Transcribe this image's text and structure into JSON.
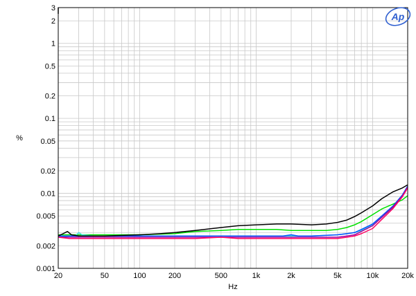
{
  "chart_data": {
    "type": "line",
    "title": "",
    "xlabel": "Hz",
    "ylabel": "%",
    "x_scale": "log",
    "y_scale": "log",
    "xlim": [
      20,
      20000
    ],
    "ylim": [
      0.001,
      3
    ],
    "grid": true,
    "legend": "none",
    "x_ticks": [
      {
        "value": 20,
        "label": "20"
      },
      {
        "value": 50,
        "label": "50"
      },
      {
        "value": 100,
        "label": "100"
      },
      {
        "value": 200,
        "label": "200"
      },
      {
        "value": 500,
        "label": "500"
      },
      {
        "value": 1000,
        "label": "1k"
      },
      {
        "value": 2000,
        "label": "2k"
      },
      {
        "value": 5000,
        "label": "5k"
      },
      {
        "value": 10000,
        "label": "10k"
      },
      {
        "value": 20000,
        "label": "20k"
      }
    ],
    "y_ticks": [
      {
        "value": 3,
        "label": "3"
      },
      {
        "value": 2,
        "label": "2"
      },
      {
        "value": 1,
        "label": "1"
      },
      {
        "value": 0.5,
        "label": "0.5"
      },
      {
        "value": 0.2,
        "label": "0.2"
      },
      {
        "value": 0.1,
        "label": "0.1"
      },
      {
        "value": 0.05,
        "label": "0.05"
      },
      {
        "value": 0.02,
        "label": "0.02"
      },
      {
        "value": 0.01,
        "label": "0.01"
      },
      {
        "value": 0.005,
        "label": "0.005"
      },
      {
        "value": 0.002,
        "label": "0.002"
      },
      {
        "value": 0.001,
        "label": "0.001"
      }
    ],
    "series": [
      {
        "color": "#00e000",
        "points": [
          [
            20,
            0.0028
          ],
          [
            30,
            0.0028
          ],
          [
            50,
            0.0028
          ],
          [
            100,
            0.0028
          ],
          [
            200,
            0.0029
          ],
          [
            300,
            0.0031
          ],
          [
            500,
            0.0032
          ],
          [
            700,
            0.0033
          ],
          [
            1000,
            0.0033
          ],
          [
            1500,
            0.0033
          ],
          [
            2000,
            0.0032
          ],
          [
            3000,
            0.0032
          ],
          [
            4000,
            0.0032
          ],
          [
            5000,
            0.0033
          ],
          [
            6000,
            0.0035
          ],
          [
            7000,
            0.0038
          ],
          [
            8000,
            0.0042
          ],
          [
            10000,
            0.0052
          ],
          [
            12000,
            0.0062
          ],
          [
            15000,
            0.0072
          ],
          [
            18000,
            0.0082
          ],
          [
            20000,
            0.0093
          ]
        ]
      },
      {
        "color": "#40e0e0",
        "points": [
          [
            20,
            0.0026
          ],
          [
            25,
            0.0027
          ],
          [
            28,
            0.0027
          ],
          [
            30,
            0.003
          ],
          [
            32,
            0.0028
          ],
          [
            40,
            0.0027
          ],
          [
            50,
            0.0027
          ],
          [
            100,
            0.0027
          ],
          [
            200,
            0.0027
          ],
          [
            500,
            0.0027
          ],
          [
            1000,
            0.0027
          ],
          [
            2000,
            0.0027
          ],
          [
            3000,
            0.0027
          ],
          [
            5000,
            0.0028
          ],
          [
            6000,
            0.0029
          ],
          [
            7000,
            0.003
          ],
          [
            8000,
            0.0032
          ],
          [
            10000,
            0.0038
          ],
          [
            12000,
            0.0048
          ],
          [
            15000,
            0.0065
          ],
          [
            18000,
            0.009
          ],
          [
            20000,
            0.012
          ]
        ]
      },
      {
        "color": "#0050ff",
        "points": [
          [
            20,
            0.0027
          ],
          [
            50,
            0.0027
          ],
          [
            100,
            0.0027
          ],
          [
            200,
            0.0027
          ],
          [
            500,
            0.0027
          ],
          [
            1000,
            0.0027
          ],
          [
            1700,
            0.0027
          ],
          [
            2000,
            0.0028
          ],
          [
            2300,
            0.0027
          ],
          [
            3000,
            0.0027
          ],
          [
            5000,
            0.0028
          ],
          [
            6000,
            0.0029
          ],
          [
            7000,
            0.003
          ],
          [
            8000,
            0.0033
          ],
          [
            10000,
            0.0039
          ],
          [
            12000,
            0.005
          ],
          [
            15000,
            0.0068
          ],
          [
            18000,
            0.0095
          ],
          [
            20000,
            0.0125
          ]
        ]
      },
      {
        "color": "#a000a0",
        "points": [
          [
            20,
            0.0026
          ],
          [
            50,
            0.0026
          ],
          [
            100,
            0.0026
          ],
          [
            200,
            0.0026
          ],
          [
            500,
            0.0026
          ],
          [
            1000,
            0.0026
          ],
          [
            2000,
            0.0026
          ],
          [
            5000,
            0.0026
          ],
          [
            6000,
            0.0027
          ],
          [
            7000,
            0.0028
          ],
          [
            8000,
            0.0031
          ],
          [
            10000,
            0.0037
          ],
          [
            12000,
            0.0048
          ],
          [
            15000,
            0.0066
          ],
          [
            18000,
            0.0092
          ],
          [
            20000,
            0.0122
          ]
        ]
      },
      {
        "color": "#ff0060",
        "points": [
          [
            20,
            0.0026
          ],
          [
            25,
            0.0025
          ],
          [
            50,
            0.0025
          ],
          [
            100,
            0.0025
          ],
          [
            200,
            0.0025
          ],
          [
            300,
            0.0025
          ],
          [
            500,
            0.0026
          ],
          [
            700,
            0.0025
          ],
          [
            1000,
            0.0025
          ],
          [
            2000,
            0.0025
          ],
          [
            3000,
            0.0025
          ],
          [
            5000,
            0.0025
          ],
          [
            6000,
            0.0026
          ],
          [
            7000,
            0.0027
          ],
          [
            8000,
            0.0029
          ],
          [
            10000,
            0.0034
          ],
          [
            12000,
            0.0045
          ],
          [
            15000,
            0.0063
          ],
          [
            18000,
            0.009
          ],
          [
            20000,
            0.0118
          ]
        ]
      },
      {
        "color": "#000000",
        "points": [
          [
            20,
            0.0027
          ],
          [
            22,
            0.0029
          ],
          [
            24,
            0.0031
          ],
          [
            26,
            0.0028
          ],
          [
            30,
            0.0027
          ],
          [
            50,
            0.0027
          ],
          [
            100,
            0.0028
          ],
          [
            150,
            0.0029
          ],
          [
            200,
            0.003
          ],
          [
            300,
            0.0032
          ],
          [
            500,
            0.0035
          ],
          [
            700,
            0.0037
          ],
          [
            1000,
            0.0038
          ],
          [
            1500,
            0.0039
          ],
          [
            2000,
            0.0039
          ],
          [
            3000,
            0.0038
          ],
          [
            4000,
            0.0039
          ],
          [
            5000,
            0.0041
          ],
          [
            6000,
            0.0044
          ],
          [
            7000,
            0.0049
          ],
          [
            8000,
            0.0055
          ],
          [
            10000,
            0.0068
          ],
          [
            12000,
            0.0085
          ],
          [
            15000,
            0.0105
          ],
          [
            18000,
            0.0118
          ],
          [
            20000,
            0.013
          ]
        ]
      }
    ]
  },
  "logo": {
    "text": "AP"
  }
}
